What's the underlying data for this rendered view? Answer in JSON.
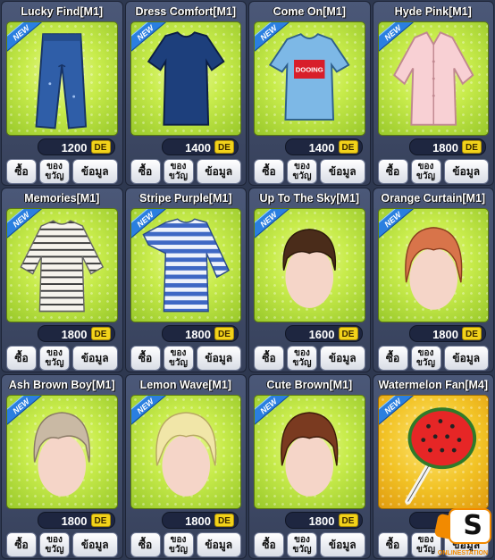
{
  "currency_label": "DE",
  "buttons": {
    "buy": "ซื้อ",
    "gift": "ของ\nขวัญ",
    "info": "ข้อมูล"
  },
  "new_badge": "NEW",
  "items": [
    {
      "name": "Lucky Find[M1]",
      "price": "1200",
      "icon": "jeans-icon",
      "is_new": true
    },
    {
      "name": "Dress Comfort[M1]",
      "price": "1400",
      "icon": "navy-tshirt-icon",
      "is_new": true
    },
    {
      "name": "Come On[M1]",
      "price": "1400",
      "icon": "blue-tshirt-icon",
      "is_new": true,
      "shirt_text": "DOOING"
    },
    {
      "name": "Hyde Pink[M1]",
      "price": "1800",
      "icon": "pink-shirt-icon",
      "is_new": true
    },
    {
      "name": "Memories[M1]",
      "price": "1800",
      "icon": "striped-shirt-icon",
      "is_new": true
    },
    {
      "name": "Stripe Purple[M1]",
      "price": "1800",
      "icon": "blue-striped-shirt-icon",
      "is_new": true
    },
    {
      "name": "Up To The Sky[M1]",
      "price": "1600",
      "icon": "brown-hair-icon",
      "is_new": true
    },
    {
      "name": "Orange Curtain[M1]",
      "price": "1800",
      "icon": "orange-hair-icon",
      "is_new": true
    },
    {
      "name": "Ash Brown Boy[M1]",
      "price": "1800",
      "icon": "ash-hair-icon",
      "is_new": true
    },
    {
      "name": "Lemon Wave[M1]",
      "price": "1800",
      "icon": "blonde-hair-icon",
      "is_new": true
    },
    {
      "name": "Cute Brown[M1]",
      "price": "1800",
      "icon": "cute-brown-hair-icon",
      "is_new": true
    },
    {
      "name": "Watermelon Fan[M4]",
      "price": "1",
      "icon": "watermelon-fan-icon",
      "is_new": true
    }
  ],
  "watermark": {
    "letter": "S",
    "text": "ONLINESTATION"
  },
  "colors": {
    "art_bg": "#b6dc3c",
    "card_bg": "#414d6a",
    "currency": "#f2d21a",
    "new_ribbon": "#2a7fe0"
  }
}
